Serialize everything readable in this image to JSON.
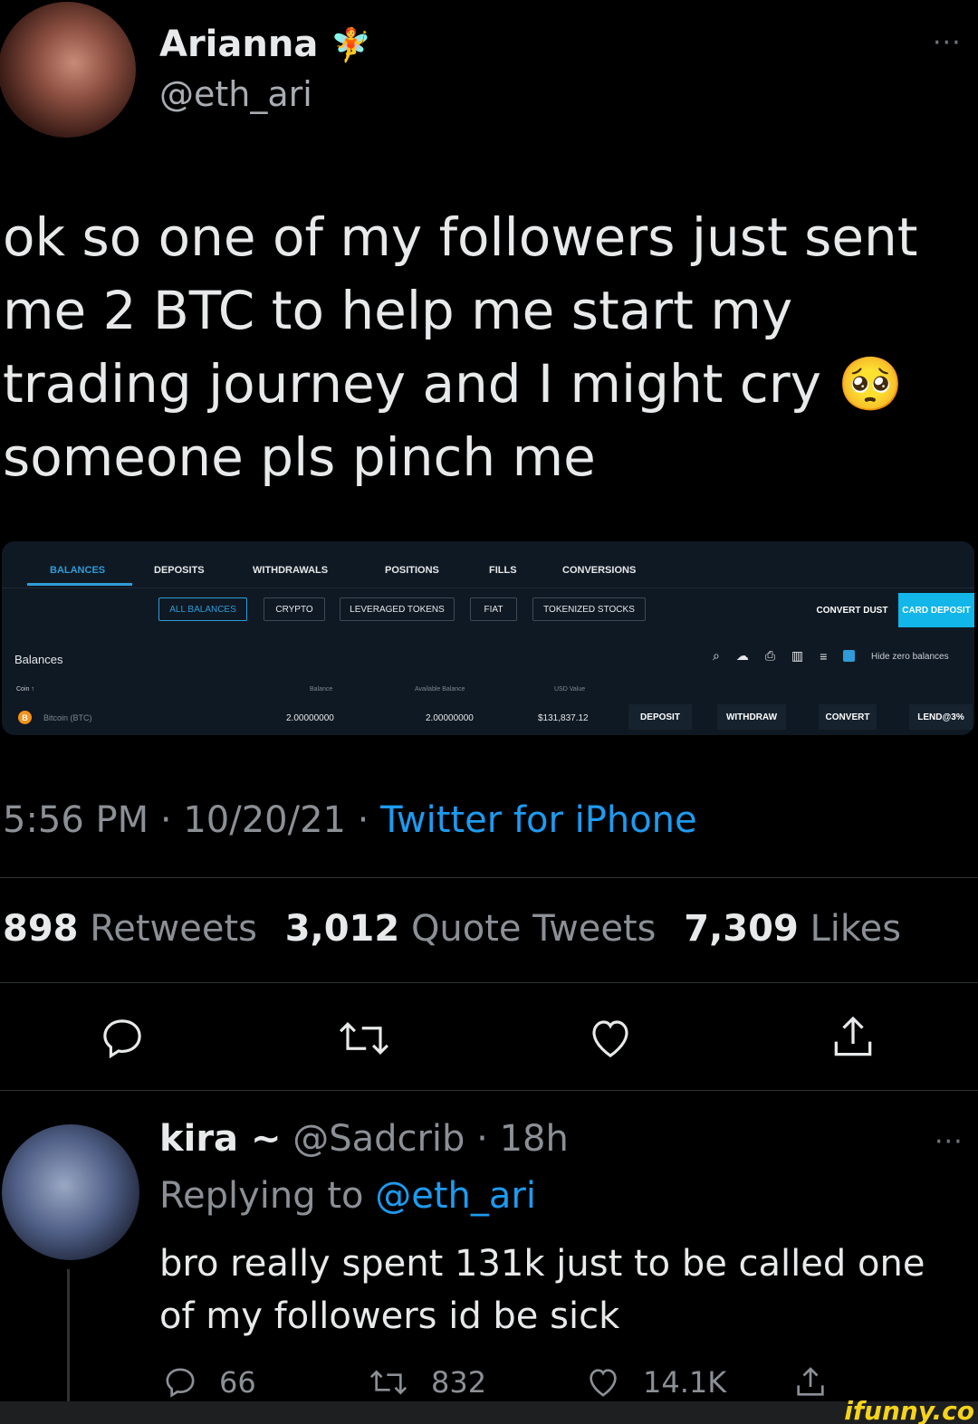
{
  "tweet": {
    "author_name": "Arianna",
    "author_emoji": "🧚",
    "handle": "@eth_ari",
    "text": "ok so one of my followers just sent me 2 BTC to help me start my trading journey and I might cry 🥺 someone pls pinch me",
    "time": "5:56 PM · 10/20/21 · ",
    "source": "Twitter for iPhone",
    "more": "···"
  },
  "stats": {
    "retweets_count": "898",
    "retweets_label": "Retweets",
    "quotes_count": "3,012",
    "quotes_label": "Quote Tweets",
    "likes_count": "7,309",
    "likes_label": "Likes"
  },
  "exchange": {
    "tabs": [
      "BALANCES",
      "DEPOSITS",
      "WITHDRAWALS",
      "POSITIONS",
      "FILLS",
      "CONVERSIONS"
    ],
    "filters": [
      "ALL BALANCES",
      "CRYPTO",
      "LEVERAGED TOKENS",
      "FIAT",
      "TOKENIZED STOCKS"
    ],
    "convert_dust": "CONVERT DUST",
    "card_deposit": "CARD DEPOSIT",
    "section_title": "Balances",
    "hide_zero": "Hide zero balances",
    "columns": [
      "Coin ↑",
      "Balance",
      "Available Balance",
      "USD Value"
    ],
    "row": {
      "coin": "Bitcoin (BTC)",
      "coin_symbol": "B",
      "balance": "2.00000000",
      "available": "2.00000000",
      "usd": "$131,837.12"
    },
    "actions": [
      "DEPOSIT",
      "WITHDRAW",
      "CONVERT",
      "LEND@3%"
    ]
  },
  "reply": {
    "author_name": "kira ~",
    "handle_time": "@Sadcrib · 18h",
    "replying_prefix": "Replying to ",
    "replying_to": "@eth_ari",
    "text": "bro really spent 131k just to be called one of my followers id be sick",
    "replies": "66",
    "retweets": "832",
    "likes": "14.1K",
    "more": "···"
  },
  "watermark": "ifunny.co"
}
